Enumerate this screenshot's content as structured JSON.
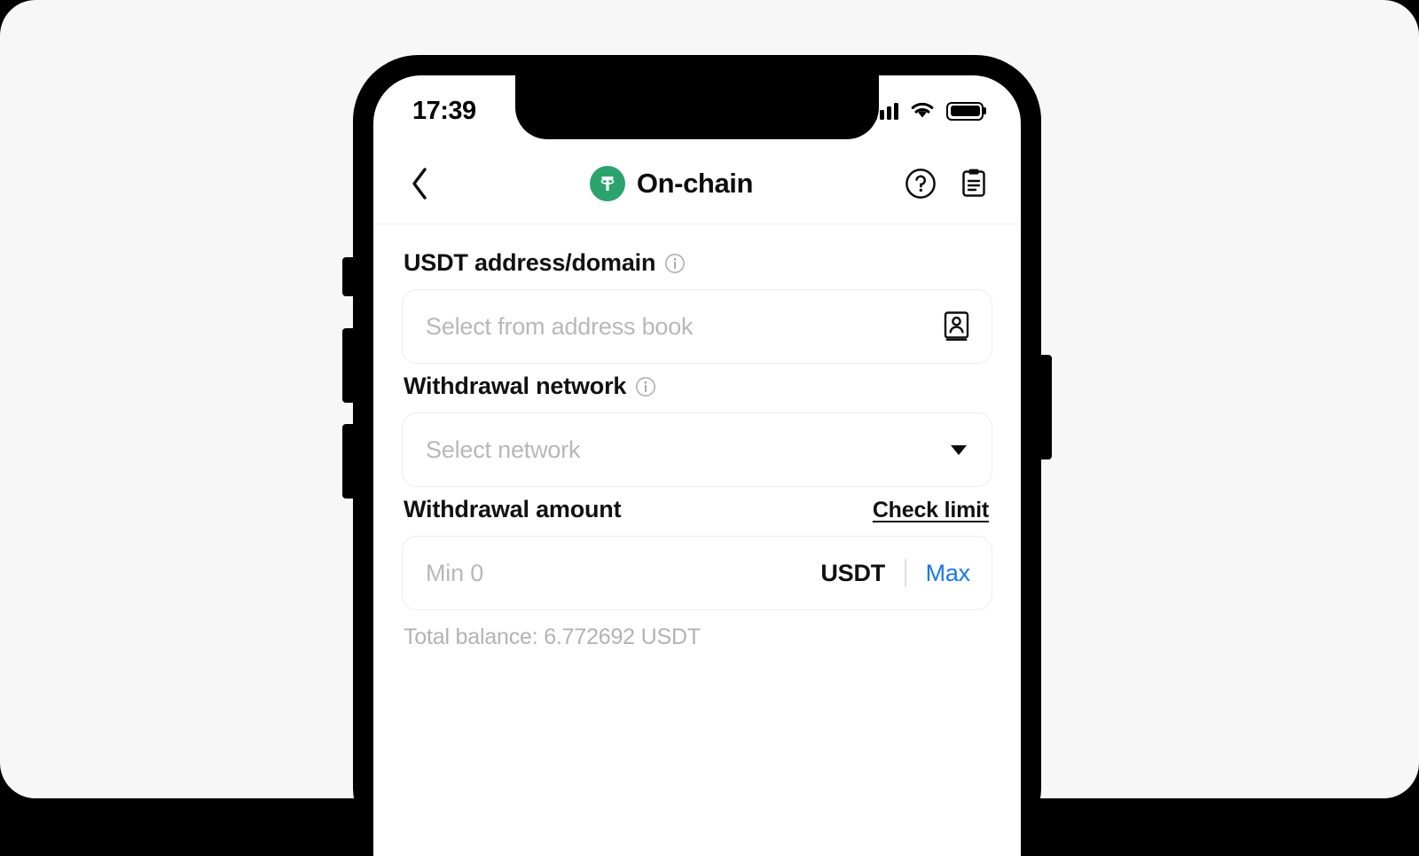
{
  "status_bar": {
    "time": "17:39",
    "signal_icon": "cellular-signal-icon",
    "wifi_icon": "wifi-icon",
    "battery_icon": "battery-full-icon"
  },
  "header": {
    "back_icon": "chevron-left-icon",
    "logo_icon": "tether-usdt-logo-icon",
    "logo_glyph": "₮",
    "title": "On-chain",
    "help_icon": "question-circle-icon",
    "records_icon": "clipboard-records-icon",
    "brand_color": "#2ba36d"
  },
  "address_field": {
    "label": "USDT address/domain",
    "info_icon": "info-circle-icon",
    "placeholder": "Select from address book",
    "trailing_icon": "address-book-icon"
  },
  "network_field": {
    "label": "Withdrawal network",
    "info_icon": "info-circle-icon",
    "placeholder": "Select network",
    "chevron_icon": "chevron-down-icon"
  },
  "amount_field": {
    "label": "Withdrawal amount",
    "check_limit_label": "Check limit",
    "placeholder": "Min 0",
    "unit": "USDT",
    "max_label": "Max",
    "max_color": "#1677ff",
    "total_balance": "Total balance: 6.772692 USDT"
  }
}
